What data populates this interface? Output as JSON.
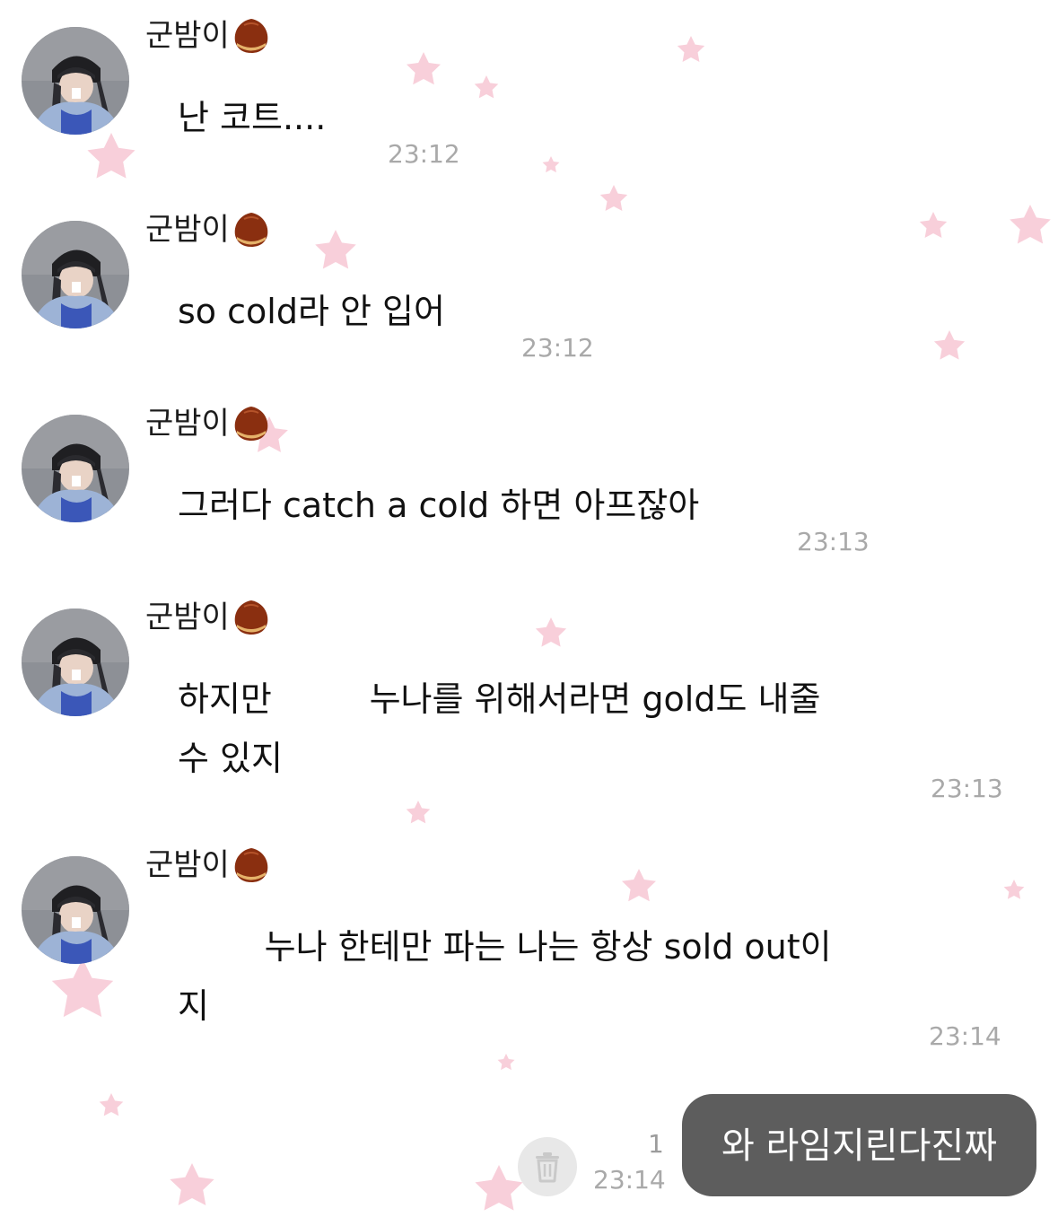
{
  "colors": {
    "background": "#ffffff",
    "sender_text": "#1c1c1c",
    "message_text": "#111111",
    "timestamp": "#a9a9a9",
    "sent_bubble": "#5d5d5d",
    "star": "#f7c7d4"
  },
  "messages": [
    {
      "sender": "군밤이",
      "sender_icon": "chestnut-icon",
      "text": "난 코트....",
      "time": "23:12"
    },
    {
      "sender": "군밤이",
      "sender_icon": "chestnut-icon",
      "text": "so cold라 안 입어",
      "time": "23:12"
    },
    {
      "sender": "군밤이",
      "sender_icon": "chestnut-icon",
      "text": "그러다 catch a cold 하면 아프잖아",
      "time": "23:13"
    },
    {
      "sender": "군밤이",
      "sender_icon": "chestnut-icon",
      "text": "하지만         누나를 위해서라면 gold도 내줄\n수 있지",
      "time": "23:13"
    },
    {
      "sender": "군밤이",
      "sender_icon": "chestnut-icon",
      "text": "        누나 한테만 파는 나는 항상 sold out이\n지",
      "time": "23:14"
    }
  ],
  "sent_message": {
    "text": "와 라임지린다진짜",
    "time": "23:14",
    "unread_count": "1",
    "delete_icon": "trash-icon"
  }
}
